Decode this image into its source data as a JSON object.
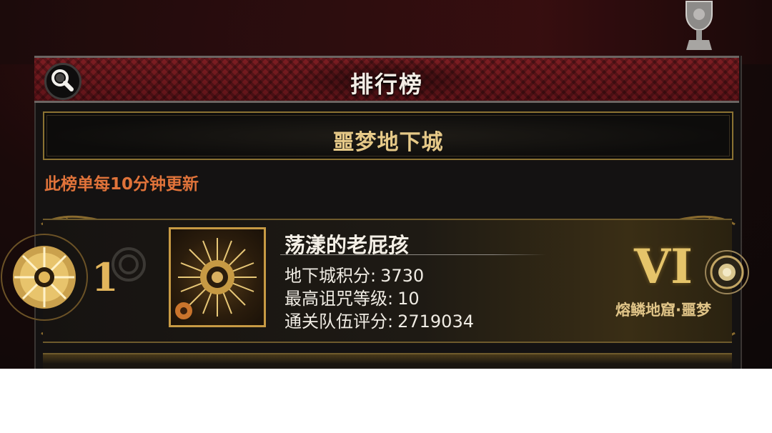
{
  "header": {
    "title": "排行榜"
  },
  "dungeon_tab": {
    "label": "噩梦地下城"
  },
  "notice": "此榜单每10分钟更新",
  "entries": [
    {
      "rank": "1",
      "player_name": "荡漾的老屁孩",
      "stats": [
        {
          "label": "地下城积分:",
          "value": "3730"
        },
        {
          "label": "最高诅咒等级:",
          "value": "10"
        },
        {
          "label": "通关队伍评分:",
          "value": "2719034"
        }
      ],
      "tier_numeral": "VI",
      "tier_name": "熔鳞地窟·噩梦"
    }
  ],
  "colors": {
    "header_red": "#7d1d22",
    "gold": "#e5c46a",
    "notice_orange": "#e0733a"
  },
  "icons": {
    "search": "magnifier-icon",
    "trophy": "trophy-icon",
    "rank_medal": "sun-medal-icon",
    "avatar": "sun-emblem-icon",
    "tier_orb": "orb-icon"
  }
}
